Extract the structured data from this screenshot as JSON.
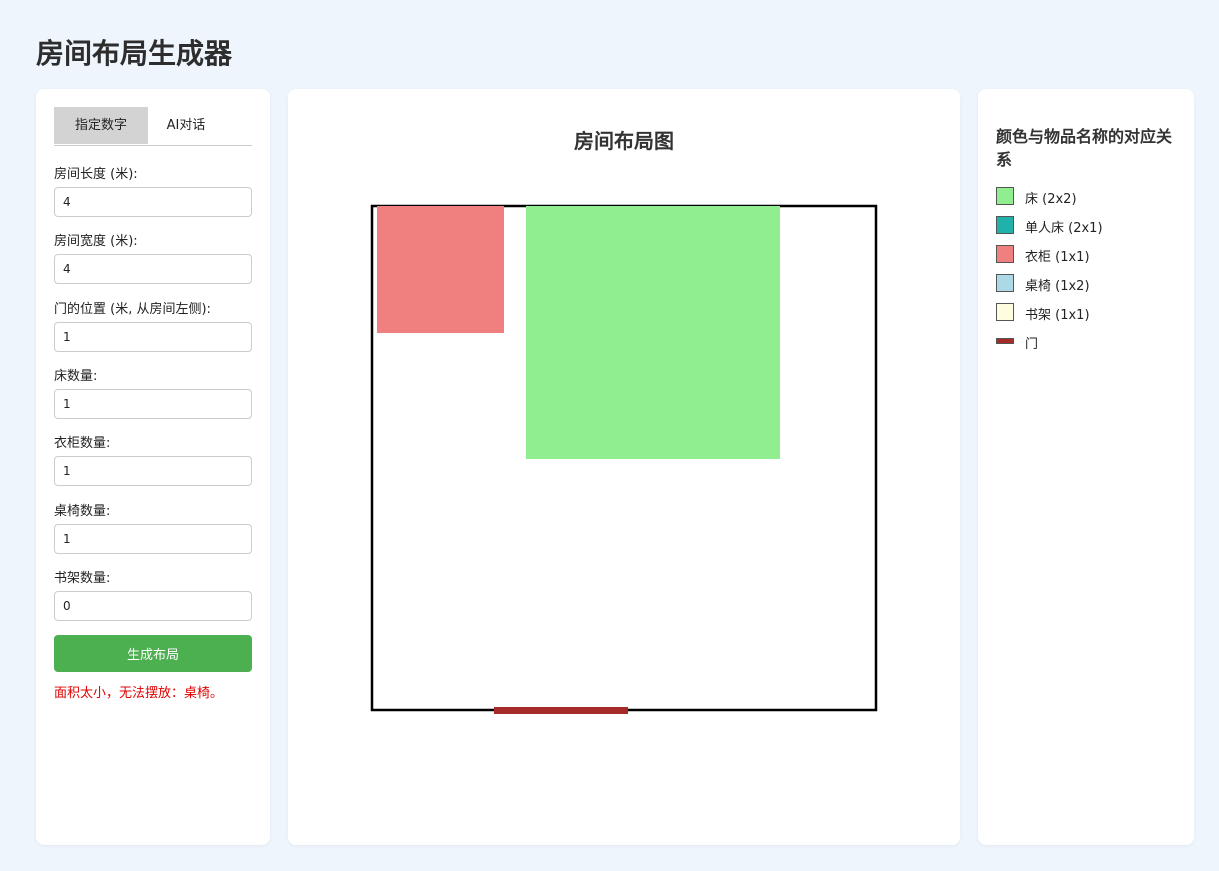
{
  "app": {
    "title": "房间布局生成器"
  },
  "tabs": [
    {
      "label": "指定数字",
      "active": true
    },
    {
      "label": "AI对话",
      "active": false
    }
  ],
  "form": {
    "fields": [
      {
        "label": "房间长度 (米):",
        "value": "4"
      },
      {
        "label": "房间宽度 (米):",
        "value": "4"
      },
      {
        "label": "门的位置 (米, 从房间左侧):",
        "value": "1"
      },
      {
        "label": "床数量:",
        "value": "1"
      },
      {
        "label": "衣柜数量:",
        "value": "1"
      },
      {
        "label": "桌椅数量:",
        "value": "1"
      },
      {
        "label": "书架数量:",
        "value": "0"
      }
    ],
    "generate_label": "生成布局",
    "error": "面积太小，无法摆放：桌椅。"
  },
  "layout": {
    "title": "房间布局图",
    "room_size_m": [
      4,
      4
    ],
    "door_position_m": 1,
    "items": [
      {
        "type": "wardrobe",
        "label": "衣柜",
        "color": "#f08080"
      },
      {
        "type": "bed",
        "label": "床",
        "color": "#90ee90"
      }
    ],
    "door_color": "#a52a2a"
  },
  "legend": {
    "title": "颜色与物品名称的对应关系",
    "items": [
      {
        "label": "床 (2x2)",
        "color": "#90ee90",
        "icon": "bed-swatch"
      },
      {
        "label": "单人床 (2x1)",
        "color": "#20b2aa",
        "icon": "single-bed-swatch"
      },
      {
        "label": "衣柜 (1x1)",
        "color": "#f08080",
        "icon": "wardrobe-swatch"
      },
      {
        "label": "桌椅 (1x2)",
        "color": "#add8e6",
        "icon": "desk-swatch"
      },
      {
        "label": "书架 (1x1)",
        "color": "#fffde0",
        "icon": "bookshelf-swatch"
      },
      {
        "label": "门",
        "color": "#a52a2a",
        "icon": "door-swatch"
      }
    ]
  }
}
